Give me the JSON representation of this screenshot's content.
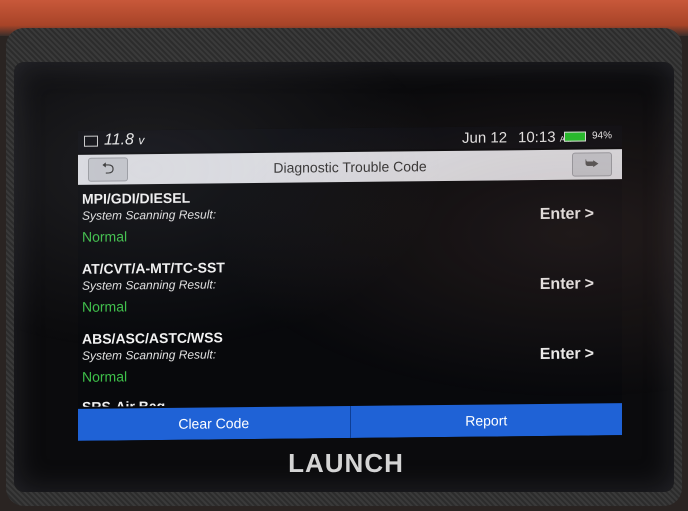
{
  "device": {
    "brand": "LAUNCH"
  },
  "status_bar": {
    "voltage": "11.8",
    "voltage_unit": "v",
    "date": "Jun 12",
    "time": "10:13",
    "ampm": "AM",
    "battery_percent": "94%",
    "battery_color": "#22c02a"
  },
  "header": {
    "title": "Diagnostic Trouble Code",
    "back_icon": "back-arrow-icon",
    "exit_icon": "exit-door-icon"
  },
  "systems": [
    {
      "name": "MPI/GDI/DIESEL",
      "scan_label": "System Scanning Result:",
      "status": "Normal",
      "enter_label": "Enter"
    },
    {
      "name": "AT/CVT/A-MT/TC-SST",
      "scan_label": "System Scanning Result:",
      "status": "Normal",
      "enter_label": "Enter"
    },
    {
      "name": "ABS/ASC/ASTC/WSS",
      "scan_label": "System Scanning Result:",
      "status": "Normal",
      "enter_label": "Enter"
    },
    {
      "name": "SRS-Air Bag",
      "scan_label": "",
      "status": "",
      "enter_label": ""
    }
  ],
  "status_color": "#3ec04a",
  "footer": {
    "clear_code_label": "Clear Code",
    "report_label": "Report",
    "button_color": "#1f62d6"
  }
}
